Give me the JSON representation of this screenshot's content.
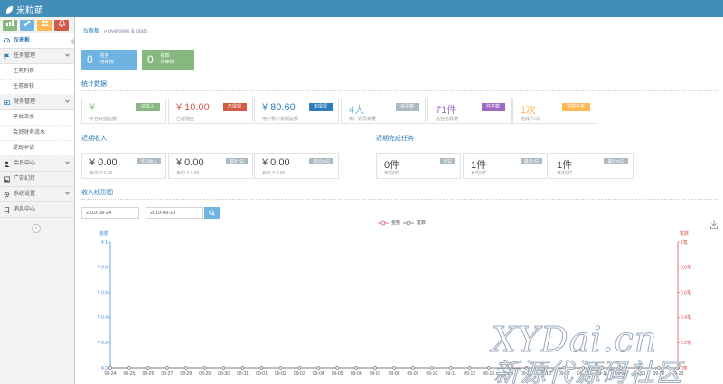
{
  "app": {
    "brand": "米粒萌"
  },
  "colors": {
    "topbar": "#438eb9",
    "link": "#2679b5",
    "green": "#87b87f",
    "red": "#d15b47",
    "blue": "#2b7dbc",
    "purple": "#a069c3",
    "orange": "#ffb752",
    "gray": "#abbac3",
    "chart_left_axis": "#4a90d9",
    "chart_right_axis": "#d9534f"
  },
  "shortcuts": [
    {
      "icon": "signal-icon",
      "color": "#87b87f"
    },
    {
      "icon": "pencil-icon",
      "color": "#6fb3e0"
    },
    {
      "icon": "users-icon",
      "color": "#ffb752"
    },
    {
      "icon": "bell-icon",
      "color": "#d15b47"
    }
  ],
  "sidebar": {
    "items": [
      {
        "label": "仪表板",
        "icon": "dashboard-icon",
        "active": true
      },
      {
        "label": "任务管理",
        "icon": "flag-icon",
        "expandable": true
      },
      {
        "label": "任务列表",
        "sub": true
      },
      {
        "label": "任务审核",
        "sub": true
      },
      {
        "label": "财务管理",
        "icon": "money-icon",
        "expandable": true
      },
      {
        "label": "平台流水",
        "sub": true
      },
      {
        "label": "会员财务流水",
        "sub": true
      },
      {
        "label": "提现申请",
        "sub": true
      },
      {
        "label": "会员中心",
        "icon": "user-icon",
        "expandable": true
      },
      {
        "label": "广告幻灯",
        "icon": "picture-icon"
      },
      {
        "label": "系统设置",
        "icon": "cog-icon",
        "expandable": true
      },
      {
        "label": "消息中心",
        "icon": "bookmark-icon"
      }
    ],
    "collapse_glyph": "«"
  },
  "breadcrumb": {
    "title": "仪表板",
    "subtitle": "» overview & stats"
  },
  "tiles": [
    {
      "num": "0",
      "line1": "任务",
      "line2": "待审核",
      "color": "#6fb3e0"
    },
    {
      "num": "0",
      "line1": "提现",
      "line2": "待审核",
      "color": "#87b87f"
    }
  ],
  "stats": {
    "title": "统计数据",
    "cards": [
      {
        "value": "¥",
        "desc": "平台充值总额",
        "tag": "总收入",
        "value_color": "#87b87f",
        "tag_color": "#87b87f"
      },
      {
        "value": "¥ 10.00",
        "desc": "已返佣金",
        "tag": "已提现",
        "value_color": "#d15b47",
        "tag_color": "#d15b47"
      },
      {
        "value": "¥ 80.60",
        "desc": "用户账户余额总额",
        "tag": "未提现",
        "value_color": "#2b7dbc",
        "tag_color": "#2b7dbc"
      },
      {
        "value": "4人",
        "desc": "推广会员数量",
        "tag": "会员数",
        "value_color": "#6fb3e0",
        "tag_color": "#abbac3"
      },
      {
        "value": "71件",
        "desc": "总任务数量",
        "tag": "任务数",
        "value_color": "#a069c3",
        "tag_color": "#a069c3"
      },
      {
        "value": "1次",
        "desc": "完成人/次",
        "tag": "完成任务",
        "value_color": "#ffb752",
        "tag_color": "#ffb752"
      }
    ]
  },
  "recent_income": {
    "title": "近期收入",
    "cards": [
      {
        "value": "¥ 0.00",
        "desc": "日均 ¥ 0.00",
        "tag": "昨日收入"
      },
      {
        "value": "¥ 0.00",
        "desc": "日均 ¥ 0.00",
        "tag": "最近7日"
      },
      {
        "value": "¥ 0.00",
        "desc": "日均 ¥ 0.00",
        "tag": "最近30日"
      }
    ]
  },
  "recent_tasks": {
    "title": "近期完成任务",
    "cards": [
      {
        "value": "0件",
        "desc": "日均0件",
        "tag": "昨日"
      },
      {
        "value": "1件",
        "desc": "日均0件",
        "tag": "最近7日"
      },
      {
        "value": "1件",
        "desc": "日均0件",
        "tag": "最近30日"
      }
    ]
  },
  "income_chart": {
    "title": "收入线形图",
    "start_date": "2019-08-24",
    "end_date": "2019-09-23",
    "date_sep": "-"
  },
  "chart_data": {
    "type": "line",
    "title": "",
    "x": [
      "08-24",
      "08-25",
      "08-26",
      "08-27",
      "08-28",
      "08-29",
      "08-30",
      "08-31",
      "09-01",
      "09-02",
      "09-03",
      "09-04",
      "09-05",
      "09-06",
      "09-07",
      "09-08",
      "09-09",
      "09-10",
      "09-11",
      "09-12",
      "09-13",
      "09-14",
      "09-15",
      "09-16",
      "09-17",
      "09-18",
      "09-19",
      "09-20",
      "09-21",
      "09-22",
      "09-23"
    ],
    "series": [
      {
        "name": "金额",
        "axis": "left",
        "color": "#d9534f",
        "values": [
          0,
          0,
          0,
          0,
          0,
          0,
          0,
          0,
          0,
          0,
          0,
          0,
          0,
          0,
          0,
          0,
          0,
          0,
          0,
          0,
          0,
          0,
          0,
          0,
          0,
          0,
          0,
          0,
          0,
          0,
          0
        ]
      },
      {
        "name": "笔数",
        "axis": "right",
        "color": "#777777",
        "values": [
          0,
          0,
          0,
          0,
          0,
          0,
          0,
          0,
          0,
          0,
          0,
          0,
          0,
          0,
          0,
          0,
          0,
          0,
          0,
          0,
          0,
          0,
          0,
          0,
          0,
          0,
          0,
          0,
          0,
          0,
          0
        ]
      }
    ],
    "ylabel_left": "金额",
    "ylabel_right": "笔数",
    "yticks_left": [
      "¥ 0",
      "¥ 0.2",
      "¥ 0.4",
      "¥ 0.6",
      "¥ 0.8",
      "¥ 1"
    ],
    "yticks_right": [
      "0笔",
      "0.2笔",
      "0.4笔",
      "0.6笔",
      "0.8笔",
      "1笔"
    ],
    "ylim": [
      0,
      1
    ],
    "grid": false,
    "legend": "top-center"
  },
  "watermark": {
    "line1": "XYDai.cn",
    "line2": "新源代源码社区"
  }
}
